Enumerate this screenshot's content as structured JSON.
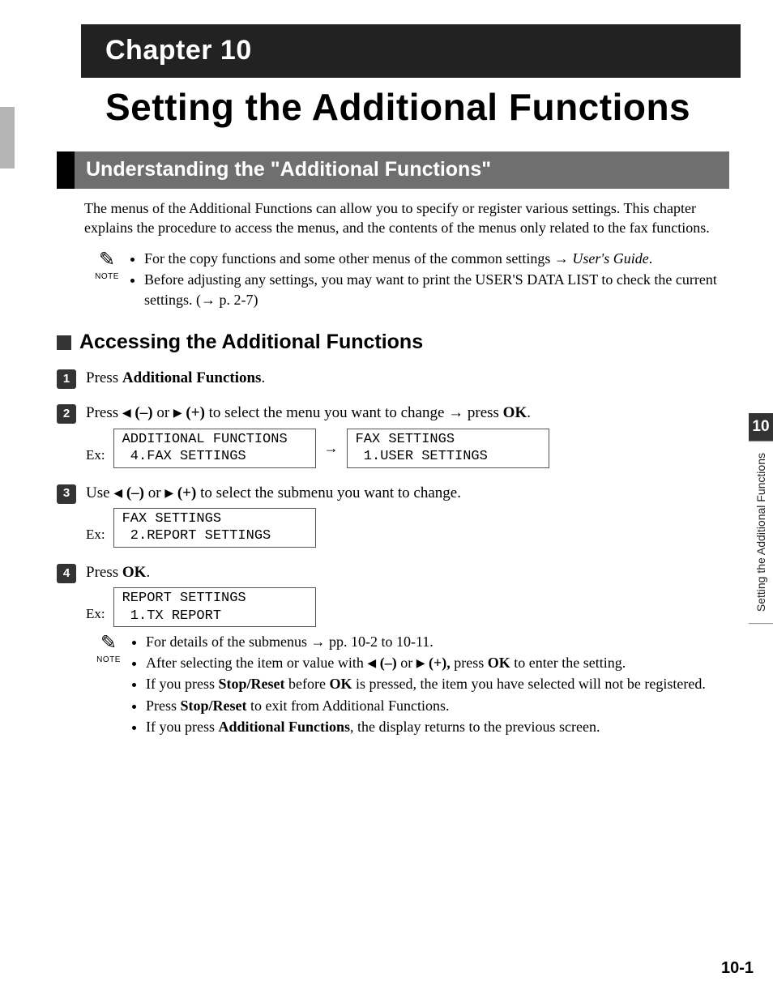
{
  "chapter": {
    "label": "Chapter 10",
    "title": "Setting the Additional Functions"
  },
  "section1": {
    "heading": "Understanding the \"Additional Functions\"",
    "intro": "The menus of the Additional Functions can allow you to specify or register various settings. This chapter explains the procedure to access the menus, and the contents of the menus only related to the fax functions.",
    "note_label": "NOTE",
    "note_items": {
      "a_pre": "For the copy functions and some other menus of the common settings → ",
      "a_ital": "User's Guide",
      "a_post": ".",
      "b": "Before adjusting any settings, you may want to print the USER'S DATA LIST to check the current settings. (→ p. 2-7)"
    }
  },
  "subsection": {
    "heading": "Accessing the Additional Functions"
  },
  "steps": {
    "s1": {
      "num": "1",
      "t1": "Press ",
      "bold": "Additional Functions",
      "t2": "."
    },
    "s2": {
      "num": "2",
      "t1": "Press ",
      "t_minus": " (–)",
      "t_or": " or ",
      "t_plus": " (+)",
      "t2": " to select the menu you want to change → press ",
      "ok": "OK",
      "t3": ".",
      "ex": "Ex:",
      "lcd1": "ADDITIONAL FUNCTIONS\n 4.FAX SETTINGS",
      "arrow": "→",
      "lcd2": "FAX SETTINGS\n 1.USER SETTINGS"
    },
    "s3": {
      "num": "3",
      "t1": "Use ",
      "t_minus": " (–)",
      "t_or": " or ",
      "t_plus": " (+)",
      "t2": " to select the submenu you want to change.",
      "ex": "Ex:",
      "lcd1": "FAX SETTINGS\n 2.REPORT SETTINGS"
    },
    "s4": {
      "num": "4",
      "t1": "Press ",
      "ok": "OK",
      "t2": ".",
      "ex": "Ex:",
      "lcd1": "REPORT SETTINGS\n 1.TX REPORT",
      "note_label": "NOTE",
      "bullets": {
        "a": "For details of the submenus → pp. 10-2 to 10-11.",
        "b_pre": "After selecting the item or value with ",
        "b_minus": " (–)",
        "b_or": " or ",
        "b_plus": " (+),",
        "b_mid": " press ",
        "b_ok": "OK",
        "b_post": " to enter the setting.",
        "c_pre": "If you press ",
        "c_sr": "Stop/Reset",
        "c_mid": " before ",
        "c_ok": "OK",
        "c_post": " is pressed, the item you have selected will not be registered.",
        "d_pre": "Press ",
        "d_sr": "Stop/Reset",
        "d_post": " to exit from Additional Functions.",
        "e_pre": "If you press ",
        "e_af": "Additional Functions",
        "e_post": ", the display returns to the previous screen."
      }
    }
  },
  "sidebar": {
    "num": "10",
    "text": "Setting the Additional Functions"
  },
  "pagenum": "10-1"
}
